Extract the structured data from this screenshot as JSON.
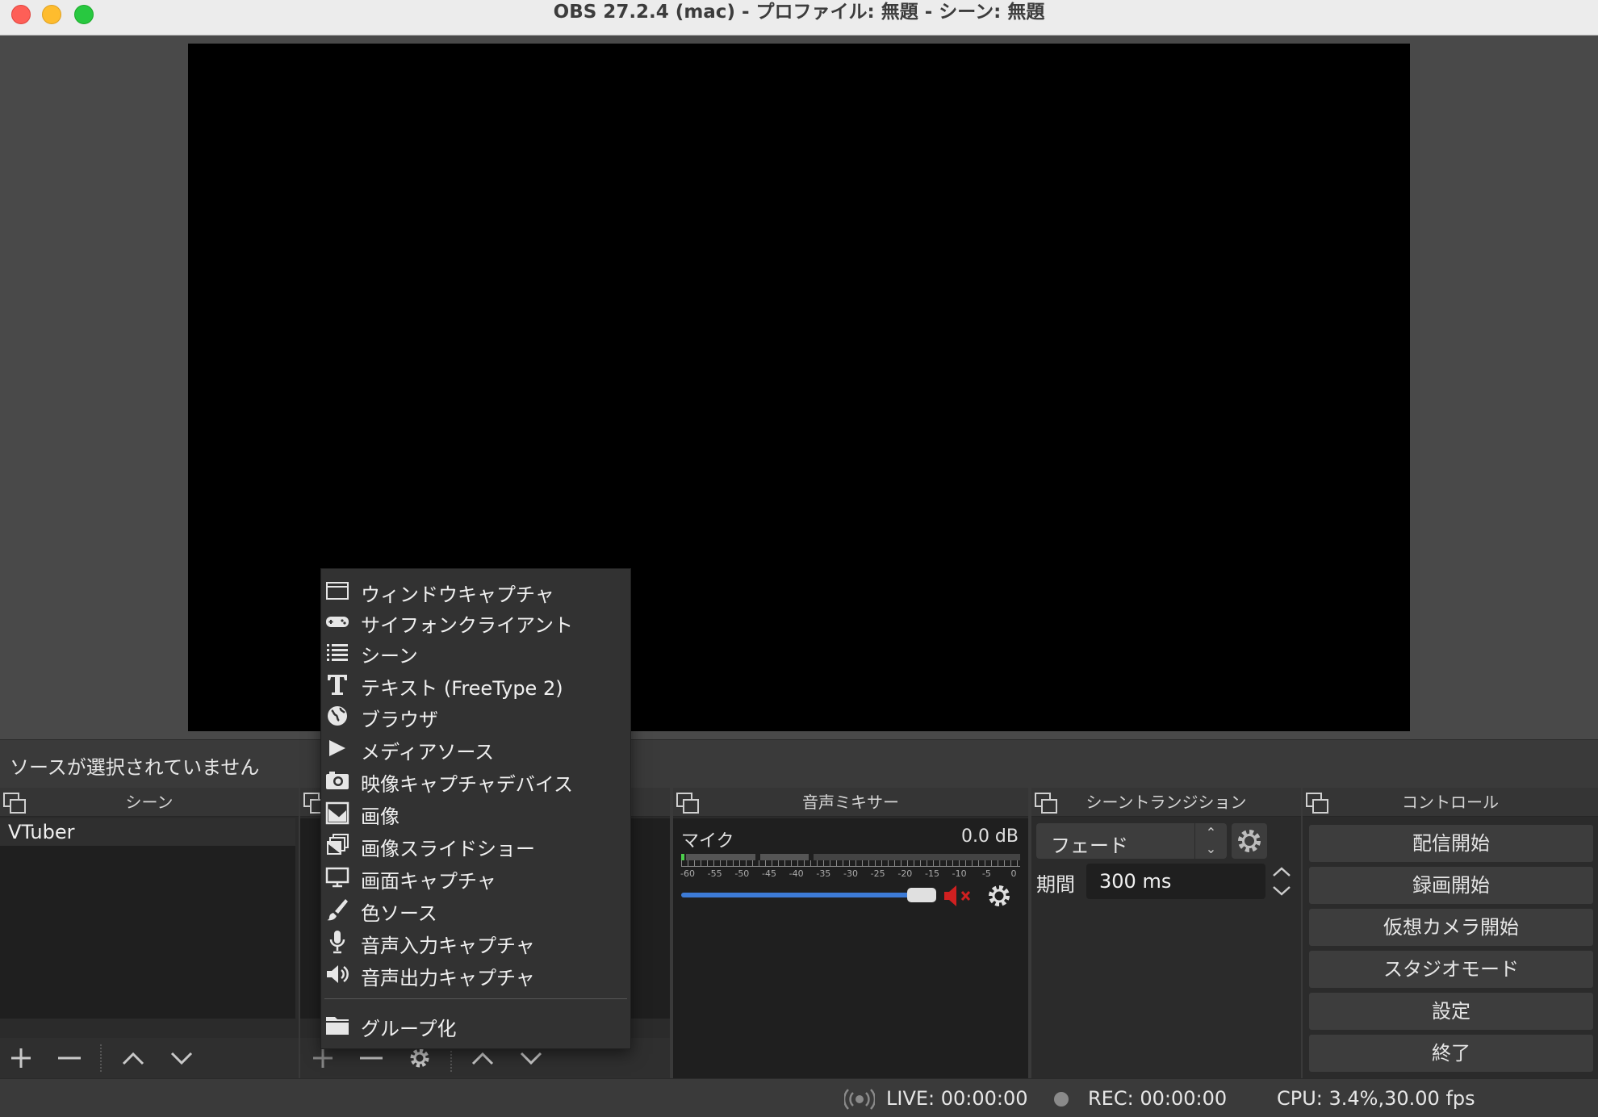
{
  "window": {
    "title": "OBS 27.2.4 (mac) - プロファイル: 無題 - シーン: 無題"
  },
  "source_status": "ソースが選択されていません",
  "scenes": {
    "title": "シーン",
    "items": [
      "VTuber"
    ]
  },
  "context_menu": {
    "items": [
      {
        "label": "ウィンドウキャプチャ",
        "icon": "window-icon"
      },
      {
        "label": "サイフォンクライアント",
        "icon": "gamepad-icon"
      },
      {
        "label": "シーン",
        "icon": "list-icon"
      },
      {
        "label": "テキスト (FreeType 2)",
        "icon": "text-icon"
      },
      {
        "label": "ブラウザ",
        "icon": "globe-icon"
      },
      {
        "label": "メディアソース",
        "icon": "play-icon"
      },
      {
        "label": "映像キャプチャデバイス",
        "icon": "camera-icon"
      },
      {
        "label": "画像",
        "icon": "image-icon"
      },
      {
        "label": "画像スライドショー",
        "icon": "slideshow-icon"
      },
      {
        "label": "画面キャプチャ",
        "icon": "monitor-icon"
      },
      {
        "label": "色ソース",
        "icon": "brush-icon"
      },
      {
        "label": "音声入力キャプチャ",
        "icon": "microphone-icon"
      },
      {
        "label": "音声出力キャプチャ",
        "icon": "speaker-icon"
      }
    ],
    "group_label": "グループ化",
    "group_icon": "folder-icon"
  },
  "mixer": {
    "title": "音声ミキサー",
    "channel_name": "マイク",
    "level_db": "0.0 dB",
    "meter_labels": [
      "-60",
      "-55",
      "-50",
      "-45",
      "-40",
      "-35",
      "-30",
      "-25",
      "-20",
      "-15",
      "-10",
      "-5",
      "0"
    ],
    "volume_fraction": 0.96,
    "muted": true
  },
  "transitions": {
    "title": "シーントランジション",
    "selected": "フェード",
    "period_label": "期間",
    "period_value": "300 ms"
  },
  "controls": {
    "title": "コントロール",
    "buttons": [
      "配信開始",
      "録画開始",
      "仮想カメラ開始",
      "スタジオモード",
      "設定",
      "終了"
    ]
  },
  "status": {
    "live": "LIVE: 00:00:00",
    "rec": "REC: 00:00:00",
    "cpu": "CPU: 3.4%,30.00 fps"
  },
  "colors": {
    "accent": "#3d7bd6",
    "mute_red": "#d02020",
    "preview_bg": "#000000"
  }
}
